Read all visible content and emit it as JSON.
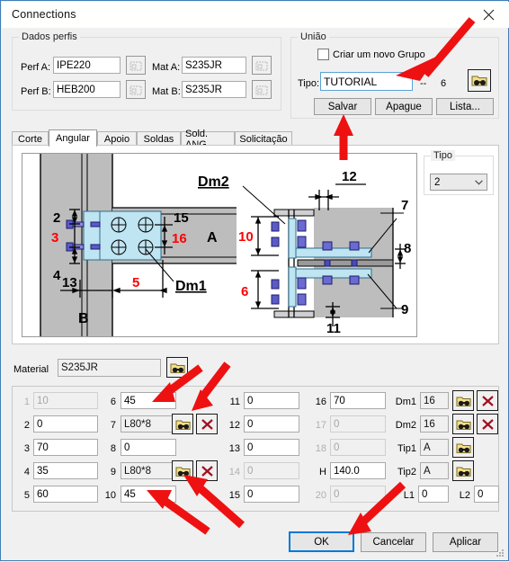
{
  "window": {
    "title": "Connections",
    "close_icon": "close-icon"
  },
  "dados_perfis": {
    "legend": "Dados perfis",
    "rows": [
      {
        "label": "Perf A:",
        "value": "IPE220",
        "mat_label": "Mat A:",
        "mat_value": "S235JR"
      },
      {
        "label": "Perf B:",
        "value": "HEB200",
        "mat_label": "Mat B:",
        "mat_value": "S235JR"
      }
    ]
  },
  "uniao": {
    "legend": "União",
    "checkbox_label": "Criar um novo Grupo",
    "checkbox_checked": false,
    "tipo_label": "Tipo:",
    "tipo_value": "TUTORIAL",
    "separator": "--",
    "count": "6",
    "buttons": {
      "salvar": "Salvar",
      "apague": "Apague",
      "lista": "Lista..."
    }
  },
  "tabs": {
    "items": [
      "Corte",
      "Angular",
      "Apoio",
      "Soldas",
      "Sold. ANG",
      "Solicitação"
    ],
    "selected": "Angular"
  },
  "tipo_group": {
    "legend": "Tipo",
    "value": "2"
  },
  "diagram": {
    "left_view": {
      "member_a": "A",
      "member_b": "B",
      "dm_label": "Dm1",
      "dims_black": [
        "2",
        "4",
        "13",
        "15"
      ],
      "dims_red": [
        "3",
        "5",
        "16"
      ]
    },
    "right_view": {
      "dm_label": "Dm2",
      "dims_black": [
        "12",
        "7",
        "8",
        "9",
        "11"
      ],
      "dims_red": [
        "10",
        "6"
      ]
    }
  },
  "material": {
    "label": "Material",
    "value": "S235JR"
  },
  "fields": {
    "col1": [
      {
        "num": "1",
        "value": "10",
        "disabled": true
      },
      {
        "num": "2",
        "value": "0",
        "disabled": false
      },
      {
        "num": "3",
        "value": "70",
        "disabled": false
      },
      {
        "num": "4",
        "value": "35",
        "disabled": false
      },
      {
        "num": "5",
        "value": "60",
        "disabled": false
      }
    ],
    "col2": [
      {
        "num": "6",
        "value": "45",
        "disabled": false,
        "browse": false,
        "clear": false
      },
      {
        "num": "7",
        "value": "L80*8",
        "disabled": false,
        "browse": true,
        "clear": true
      },
      {
        "num": "8",
        "value": "0",
        "disabled": false,
        "browse": false,
        "clear": false
      },
      {
        "num": "9",
        "value": "L80*8",
        "disabled": false,
        "browse": true,
        "clear": true
      },
      {
        "num": "10",
        "value": "45",
        "disabled": false,
        "browse": false,
        "clear": false
      }
    ],
    "col3": [
      {
        "num": "11",
        "value": "0",
        "disabled": false
      },
      {
        "num": "12",
        "value": "0",
        "disabled": false
      },
      {
        "num": "13",
        "value": "0",
        "disabled": false
      },
      {
        "num": "14",
        "value": "0",
        "disabled": true
      },
      {
        "num": "15",
        "value": "0",
        "disabled": false
      }
    ],
    "col4": [
      {
        "num": "16",
        "value": "70",
        "disabled": false
      },
      {
        "num": "17",
        "value": "0",
        "disabled": true
      },
      {
        "num": "18",
        "value": "0",
        "disabled": true
      },
      {
        "num": "H",
        "value": "140.0",
        "disabled": false
      },
      {
        "num": "20",
        "value": "0",
        "disabled": true
      }
    ],
    "col5": [
      {
        "num": "Dm1",
        "value": "16",
        "browse": true,
        "clear": true
      },
      {
        "num": "Dm2",
        "value": "16",
        "browse": true,
        "clear": true
      },
      {
        "num": "Tip1",
        "value": "A",
        "browse": true,
        "clear": false
      },
      {
        "num": "Tip2",
        "value": "A",
        "browse": true,
        "clear": false
      }
    ],
    "l1": {
      "label": "L1",
      "value": "0"
    },
    "l2": {
      "label": "L2",
      "value": "0"
    }
  },
  "footer": {
    "ok": "OK",
    "cancel": "Cancelar",
    "apply": "Aplicar"
  },
  "colors": {
    "accent": "#0078d7",
    "annotation_red": "#ee1111",
    "dim_red": "#ff0000",
    "plate_blue": "#bfe4f2",
    "steel_gray": "#bdbdbd"
  }
}
